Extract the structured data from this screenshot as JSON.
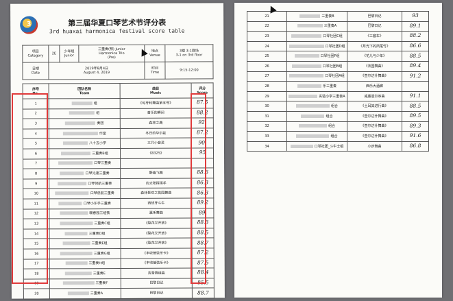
{
  "left_sheet": {
    "logo_text": "3",
    "title_cn": "第三届华夏口琴艺术节评分表",
    "title_en": "3rd huaxai harmonica festival score table",
    "info": {
      "category_label": "项目\nCategory",
      "code": "2E",
      "level": "少年组\nJunior",
      "category_value": "三重奏(预) Junior\nHarmonica Trio\n(Pre)",
      "venue_label": "地点\nVenue",
      "venue_value": "3楼 3-1赛场\n3-1 on 3rd floor",
      "date_label": "日期\nDate",
      "date_value": "2019年8月4日\nAugust 4, 2019",
      "time_label": "时间\nTime",
      "time_value": "9:15-12:00"
    },
    "headers": {
      "no": "序号\nNo.",
      "team": "团队名称\nTeam",
      "music": "曲目\nMusic",
      "score": "评分\nScore"
    },
    "rows": [
      {
        "no": "1",
        "team": "组",
        "music": "《匈牙利舞曲第五号》",
        "score": "87.5"
      },
      {
        "no": "2",
        "team": "组",
        "music": "音乐的瞬间",
        "score": "88.2"
      },
      {
        "no": "3",
        "team": "奏团",
        "music": "森林之鹰",
        "score": "92."
      },
      {
        "no": "4",
        "team": "作室",
        "music": "冬日的华尔兹",
        "score": "87.2"
      },
      {
        "no": "5",
        "team": "八十五小学",
        "music": "三只小音灵",
        "score": "90."
      },
      {
        "no": "6",
        "team": "三重奏B组",
        "music": "《8325》",
        "score": "95"
      },
      {
        "no": "7",
        "team": "口琴三重奏",
        "music": "",
        "score": ""
      },
      {
        "no": "8",
        "team": "口琴光速三重奏",
        "music": "野蜂飞舞",
        "score": "88.6"
      },
      {
        "no": "9",
        "team": "口琴领航三重奏",
        "music": "向太阳挥挥手",
        "score": "86.3"
      },
      {
        "no": "10",
        "team": "口琴启航三重奏",
        "music": "森林狂欢之挑园舞曲",
        "score": "86.3"
      },
      {
        "no": "11",
        "team": "口琴小乐手三重奏",
        "music": "西班牙斗牛",
        "score": "89.2"
      },
      {
        "no": "12",
        "team": "暖春园三组铁",
        "music": "嘉禾舞曲",
        "score": "89."
      },
      {
        "no": "13",
        "team": "三重奏C组",
        "music": "《梨花又开放》",
        "score": "88.3"
      },
      {
        "no": "14",
        "team": "三重奏D组",
        "music": "《梨花又开放》",
        "score": "88.5"
      },
      {
        "no": "15",
        "team": "三重奏E组",
        "music": "《梨花又开放》",
        "score": "88.7"
      },
      {
        "no": "16",
        "team": "三重奏G组",
        "music": "《丰收管弦乐卡》",
        "score": "87.2"
      },
      {
        "no": "17",
        "team": "三重奏H组",
        "music": "《丰收管弦乐卡》",
        "score": "87.5"
      },
      {
        "no": "18",
        "team": "三重奏E",
        "music": "吉普赛组曲",
        "score": "88.4"
      },
      {
        "no": "19",
        "team": "三重奏F",
        "music": "巴黎日记",
        "score": "85.5"
      },
      {
        "no": "20",
        "team": "三重奏A",
        "music": "巴黎日记",
        "score": "88.7"
      }
    ]
  },
  "right_sheet": {
    "rows": [
      {
        "no": "21",
        "team": "三重奏B",
        "music": "巴黎日记",
        "score": "93"
      },
      {
        "no": "22",
        "team": "三重奏A",
        "music": "巴黎日记",
        "score": "89.1"
      },
      {
        "no": "23",
        "team": "口琴社团C组",
        "music": "《三套车》",
        "score": "88.2"
      },
      {
        "no": "24",
        "team": "口琴社团D组",
        "music": "《月光下的凤尾竹》",
        "score": "86.6"
      },
      {
        "no": "25",
        "team": "口琴社团F组",
        "music": "《花儿与少年》",
        "score": "88.5"
      },
      {
        "no": "26",
        "team": "口琴社团B组",
        "music": "《法国舞曲》",
        "score": "89.4"
      },
      {
        "no": "27",
        "team": "口琴社团A组",
        "music": "《查尔达什舞曲》",
        "score": "91.2"
      },
      {
        "no": "28",
        "team": "乐三重奏",
        "music": "西乐大酒廊",
        "score": ""
      },
      {
        "no": "29",
        "team": "实验小学三重奏A",
        "music": "威廉退尔序曲",
        "score": "91.1"
      },
      {
        "no": "30",
        "team": "组合",
        "music": "《土耳其进行曲》",
        "score": "88.5"
      },
      {
        "no": "31",
        "team": "组合",
        "music": "《查尔达什舞曲》",
        "score": "89.5"
      },
      {
        "no": "32",
        "team": "组合",
        "music": "《查尔达什舞曲》",
        "score": "89.3"
      },
      {
        "no": "33",
        "team": "组合",
        "music": "《查尔达什舞曲》",
        "score": "91.6"
      },
      {
        "no": "34",
        "team": "口琴社团_斗牛士组",
        "music": "小步舞曲",
        "score": "86.8"
      }
    ]
  }
}
